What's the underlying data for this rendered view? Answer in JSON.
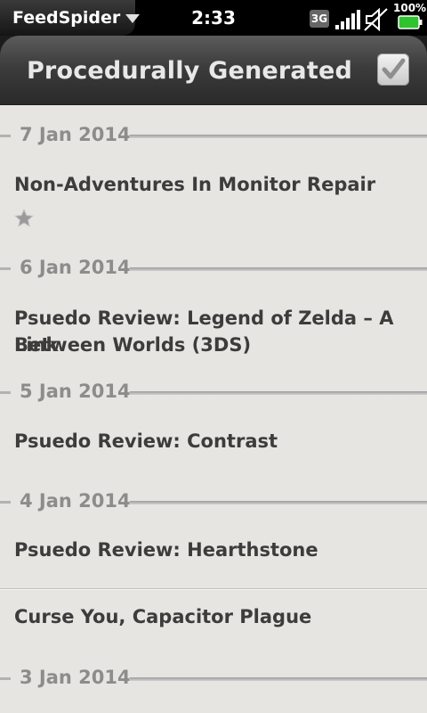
{
  "status_bar": {
    "app_name": "FeedSpider",
    "time": "2:33",
    "network": "3G",
    "battery": "100%"
  },
  "header": {
    "title": "Procedurally Generated",
    "mark_read_icon": "checkmark-icon"
  },
  "feed": {
    "groups": [
      {
        "date": "7 Jan 2014",
        "items": [
          {
            "title": "Non-Adventures In Monitor Repair",
            "starred": false
          }
        ]
      },
      {
        "date": "6 Jan 2014",
        "items": [
          {
            "title_line1": "Psuedo Review: Legend of Zelda – A Link",
            "title_line2": "Between Worlds (3DS)"
          }
        ]
      },
      {
        "date": "5 Jan 2014",
        "items": [
          {
            "title": "Psuedo Review: Contrast"
          }
        ]
      },
      {
        "date": "4 Jan 2014",
        "items": [
          {
            "title": "Psuedo Review: Hearthstone"
          },
          {
            "title": "Curse You, Capacitor Plague"
          }
        ]
      },
      {
        "date": "3 Jan 2014",
        "items": []
      }
    ]
  },
  "colors": {
    "background": "#e7e5e1",
    "header": "#3c3c3c",
    "text": "#3c3c3c",
    "date_text": "#8c8c8c"
  }
}
